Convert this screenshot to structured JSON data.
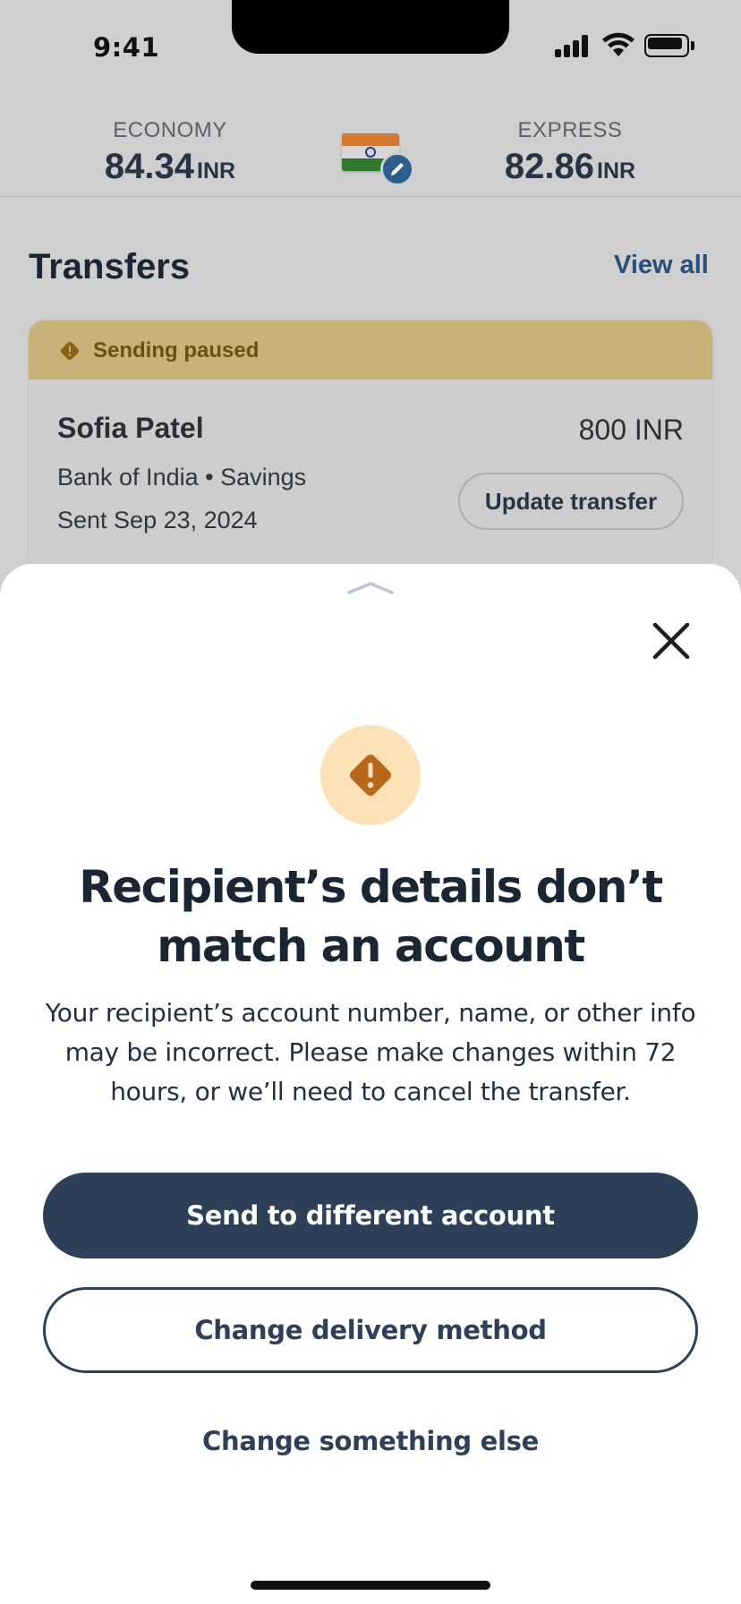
{
  "status_bar": {
    "time": "9:41"
  },
  "rates": {
    "economy": {
      "label": "ECONOMY",
      "value": "84.34",
      "unit": "INR"
    },
    "express": {
      "label": "EXPRESS",
      "value": "82.86",
      "unit": "INR"
    }
  },
  "transfers": {
    "title": "Transfers",
    "view_all": "View all",
    "card": {
      "status": "Sending paused",
      "recipient": "Sofia Patel",
      "amount": "800 INR",
      "bank": "Bank of India • Savings",
      "sent": "Sent Sep 23, 2024",
      "action": "Update transfer"
    }
  },
  "sheet": {
    "heading": "Recipient’s details don’t match an account",
    "description": "Your recipient’s account number, name, or other info may be incorrect. Please make changes within 72 hours, or we’ll need to cancel the transfer.",
    "primary_button": "Send to different account",
    "secondary_button": "Change delivery method",
    "tertiary_button": "Change something else"
  },
  "colors": {
    "primary": "#2d4058",
    "link": "#294e78",
    "paused_banner": "#c8b27a",
    "warning_icon": "#b9671a",
    "warning_circle": "#fde2b7"
  },
  "icons": {
    "close": "close-icon",
    "warning": "warning-diamond-icon",
    "edit": "pencil-icon",
    "flag": "india-flag-icon"
  }
}
